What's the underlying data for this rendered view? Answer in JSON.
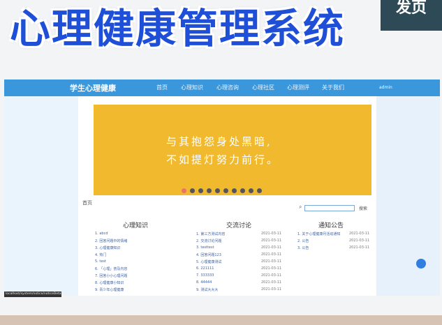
{
  "hero": {
    "title": "心理健康管理系统",
    "ribbon": "发页"
  },
  "nav": {
    "logo": "学生心理健康",
    "items": [
      "首页",
      "心理知识",
      "心理咨询",
      "心理社区",
      "心理测评",
      "关于我们"
    ],
    "user": "admin"
  },
  "banner": {
    "line1": "与其抱怨身处黑暗,",
    "line2": "不如提灯努力前行。",
    "active_dot": 0,
    "dot_count": 10
  },
  "breadcrumb": "首页",
  "search": {
    "button": "搜索"
  },
  "columns": {
    "knowledge": {
      "title": "心理知识",
      "items": [
        "1. abcd",
        "2. 回答问题中的情绪",
        "3. 心理健康知识",
        "4. 热门",
        "5. test",
        "6. 「心理」普及内容",
        "7. 回答小小心理问题",
        "8. 心理健康小知识",
        "9. 青少年心理健康"
      ]
    },
    "community": {
      "title": "交流讨论",
      "items": [
        "1. 第三方测试内容",
        "2. 交流讨论问题",
        "3. testtest",
        "4. 回答问题123",
        "5. 心理健康测试",
        "6. 221111",
        "7. 333333",
        "8. 44444",
        "9. 测试大大大"
      ],
      "dates": [
        "2021-03-11",
        "2021-03-11",
        "2021-03-11",
        "2021-03-11",
        "2021-03-11",
        "2021-03-11",
        "2021-03-11",
        "2021-03-11",
        "2021-03-11"
      ]
    },
    "notice": {
      "title": "通知公告",
      "items": [
        "1. 关于心理健康月活动通知",
        "2. 公告",
        "3. 公告"
      ],
      "dates": [
        "2021-03-11",
        "2021-03-11",
        "2021-03-11"
      ]
    }
  },
  "status_bar": "localhost/system/notice/noticeDetails/1"
}
